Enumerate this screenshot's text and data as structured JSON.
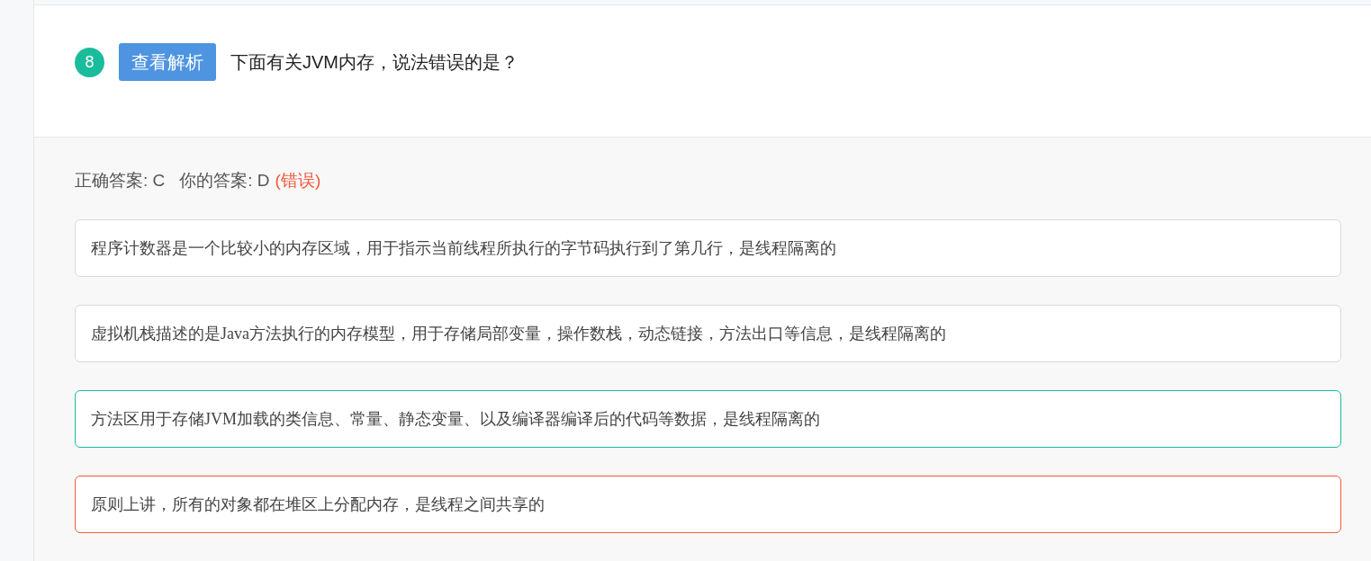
{
  "question": {
    "number": "8",
    "analysis_button": "查看解析",
    "text": "下面有关JVM内存，说法错误的是？"
  },
  "answer": {
    "correct_label": "正确答案: C",
    "your_label": "你的答案: D",
    "verdict": "(错误)"
  },
  "options": [
    {
      "text": "程序计数器是一个比较小的内存区域，用于指示当前线程所执行的字节码执行到了第几行，是线程隔离的",
      "kind": "plain"
    },
    {
      "text": "虚拟机栈描述的是Java方法执行的内存模型，用于存储局部变量，操作数栈，动态链接，方法出口等信息，是线程隔离的",
      "kind": "plain"
    },
    {
      "text": "方法区用于存储JVM加载的类信息、常量、静态变量、以及编译器编译后的代码等数据，是线程隔离的",
      "kind": "correct"
    },
    {
      "text": "原则上讲，所有的对象都在堆区上分配内存，是线程之间共享的",
      "kind": "wrong"
    }
  ]
}
